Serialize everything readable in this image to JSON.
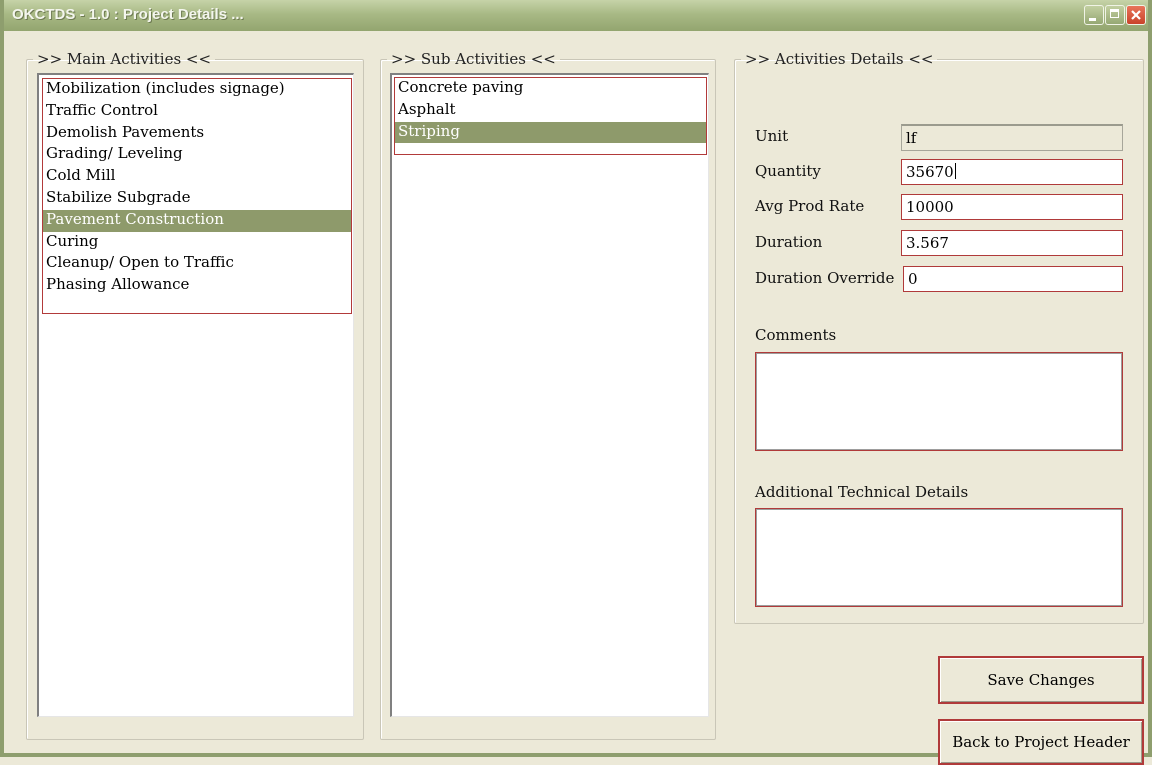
{
  "window": {
    "title": "OKCTDS - 1.0 : Project Details ..."
  },
  "main_activities": {
    "legend": ">> Main Activities <<",
    "items": [
      {
        "label": "Mobilization (includes signage)",
        "selected": false
      },
      {
        "label": "Traffic Control",
        "selected": false
      },
      {
        "label": "Demolish Pavements",
        "selected": false
      },
      {
        "label": "Grading/ Leveling",
        "selected": false
      },
      {
        "label": "Cold Mill",
        "selected": false
      },
      {
        "label": "Stabilize Subgrade",
        "selected": false
      },
      {
        "label": "Pavement Construction",
        "selected": true
      },
      {
        "label": "Curing",
        "selected": false
      },
      {
        "label": "Cleanup/ Open to Traffic",
        "selected": false
      },
      {
        "label": "Phasing Allowance",
        "selected": false
      }
    ]
  },
  "sub_activities": {
    "legend": ">> Sub Activities <<",
    "items": [
      {
        "label": "Concrete paving",
        "selected": false
      },
      {
        "label": "Asphalt",
        "selected": false
      },
      {
        "label": "Striping",
        "selected": true
      }
    ]
  },
  "details": {
    "legend": ">> Activities Details <<",
    "unit_label": "Unit",
    "unit_value": "lf",
    "quantity_label": "Quantity",
    "quantity_value": "35670",
    "avg_prod_rate_label": "Avg Prod Rate",
    "avg_prod_rate_value": "10000",
    "duration_label": "Duration",
    "duration_value": "3.567",
    "duration_override_label": "Duration Override",
    "duration_override_value": "0",
    "comments_label": "Comments",
    "comments_value": "",
    "additional_label": "Additional Technical Details",
    "additional_value": ""
  },
  "buttons": {
    "save": "Save Changes",
    "back": "Back to Project Header"
  },
  "colors": {
    "titlebar": "#9cad7b",
    "selection": "#8e9a6b",
    "accent_border": "#b03a3a",
    "window_bg": "#ece9d8"
  }
}
